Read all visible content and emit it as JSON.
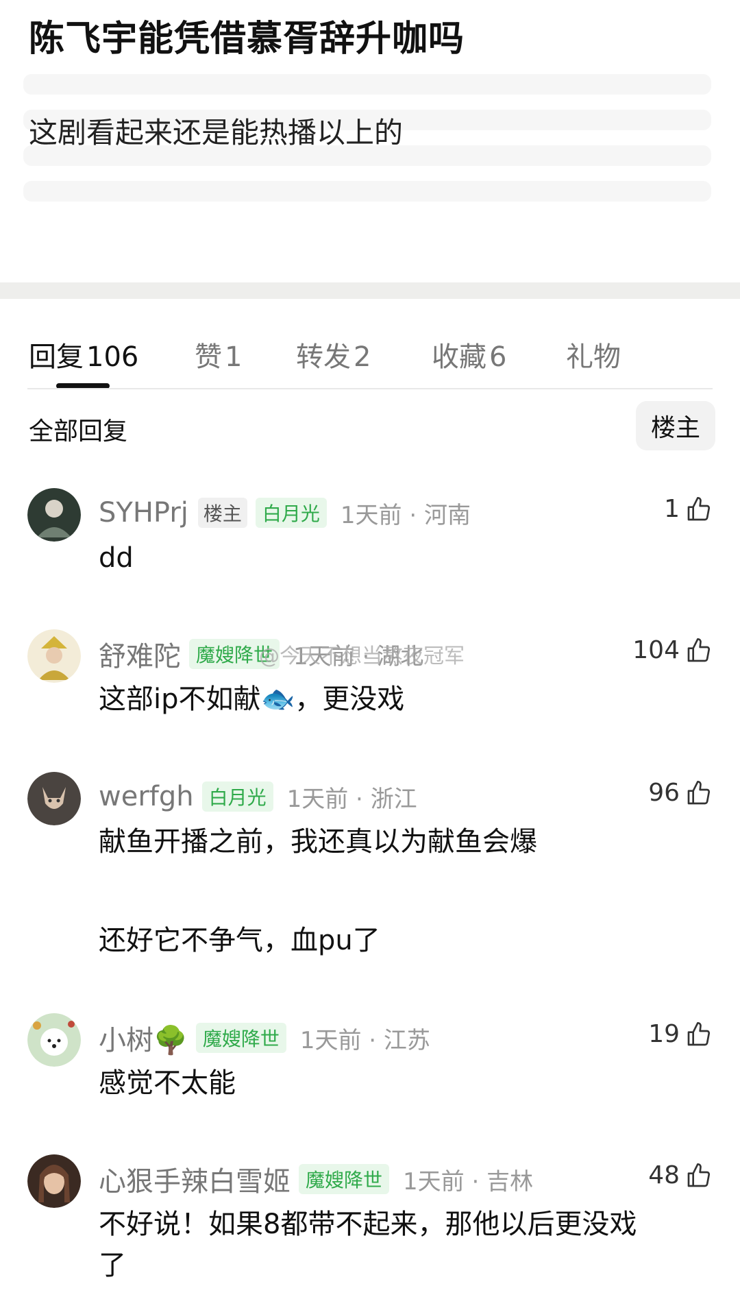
{
  "post": {
    "title": "陈飞宇能凭借慕胥辞升咖吗",
    "body": "这剧看起来还是能热播以上的"
  },
  "tabs": [
    {
      "label": "回复",
      "count": "106"
    },
    {
      "label": "赞",
      "count": "1"
    },
    {
      "label": "转发",
      "count": "2"
    },
    {
      "label": "收藏",
      "count": "6"
    },
    {
      "label": "礼物",
      "count": ""
    }
  ],
  "section": {
    "all_replies": "全部回复",
    "owner_filter": "楼主"
  },
  "comments": [
    {
      "user": "SYHPrj",
      "owner_badge": "楼主",
      "badge": "白月光",
      "time": "1天前",
      "location": "河南",
      "likes": "1",
      "lines": [
        "dd"
      ],
      "avatar_color": "#3a4a3f"
    },
    {
      "user": "舒难陀",
      "owner_badge": "",
      "badge": "魔嫂降世",
      "time": "1天前",
      "location": "湖北",
      "likes": "104",
      "lines": [
        "这部ip不如献🐟，更没戏"
      ],
      "avatar_color": "#c9b15a"
    },
    {
      "user": "werfgh",
      "owner_badge": "",
      "badge": "白月光",
      "time": "1天前",
      "location": "浙江",
      "likes": "96",
      "lines": [
        "献鱼开播之前，我还真以为献鱼会爆",
        "",
        "还好它不争气，血pu了"
      ],
      "avatar_color": "#8a7d73"
    },
    {
      "user": "小树🌳",
      "owner_badge": "",
      "badge": "魔嫂降世",
      "time": "1天前",
      "location": "江苏",
      "likes": "19",
      "lines": [
        "感觉不太能"
      ],
      "avatar_color": "#9cc49a"
    },
    {
      "user": "心狠手辣白雪姬",
      "owner_badge": "",
      "badge": "魔嫂降世",
      "time": "1天前",
      "location": "吉林",
      "likes": "48",
      "lines": [
        "不好说！如果8都带不起来，那他以后更没戏",
        "了"
      ],
      "avatar_color": "#5a3a2e"
    }
  ],
  "watermark": "@今天不想当熬夜冠军",
  "colors": {
    "badge_green": "#2faa4a",
    "divider": "#eeeeec"
  }
}
